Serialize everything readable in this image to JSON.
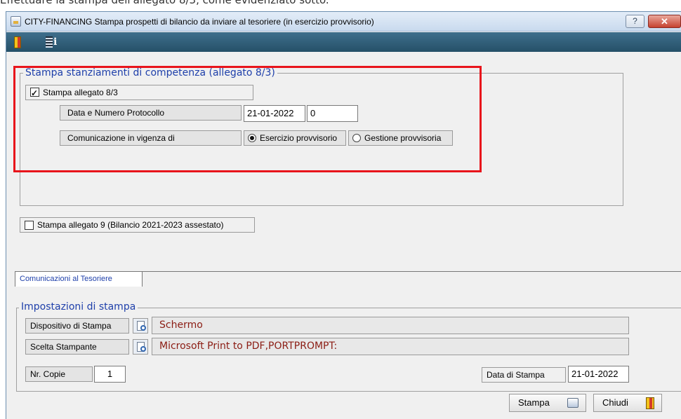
{
  "caption": "Effettuare la stampa dell'allegato 8/3, come evidenziato sotto.",
  "window": {
    "title": "CITY-FINANCING  Stampa prospetti di bilancio da inviare al tesoriere (in esercizio provvisorio)",
    "help_label": "?",
    "close_label": "✕"
  },
  "toolbar": {
    "items": [
      "exit-icon",
      "info-icon"
    ]
  },
  "competenza": {
    "legend": "Stampa stanziamenti di competenza (allegato 8/3)",
    "print_label": "Stampa allegato 8/3",
    "print_checked": true,
    "protocol_label": "Data e Numero Protocollo",
    "protocol_date": "21-01-2022",
    "protocol_number": "0",
    "vigenza_label": "Comunicazione in vigenza di",
    "options": [
      "Esercizio provvisorio",
      "Gestione provvisoria"
    ],
    "selected": "Esercizio provvisorio"
  },
  "allegato9": {
    "label": "Stampa allegato 9  (Bilancio 2021-2023 assestato)",
    "checked": false
  },
  "tab": {
    "label": "Comunicazioni al Tesoriere"
  },
  "stampa": {
    "legend": "Impostazioni di stampa",
    "device_label": "Dispositivo di Stampa",
    "device_value": "Schermo",
    "printer_label": "Scelta Stampante",
    "printer_value": "Microsoft Print to PDF,PORTPROMPT:",
    "copies_label": "Nr. Copie",
    "copies_value": "1",
    "date_label": "Data di Stampa",
    "date_value": "21-01-2022"
  },
  "buttons": {
    "print_label": "Stampa",
    "close_label": "Chiudi"
  },
  "colors": {
    "legend": "#1e3faa",
    "highlight": "#e8141b",
    "value_text": "#8b1c13",
    "toolbar": "#2f5d78"
  }
}
